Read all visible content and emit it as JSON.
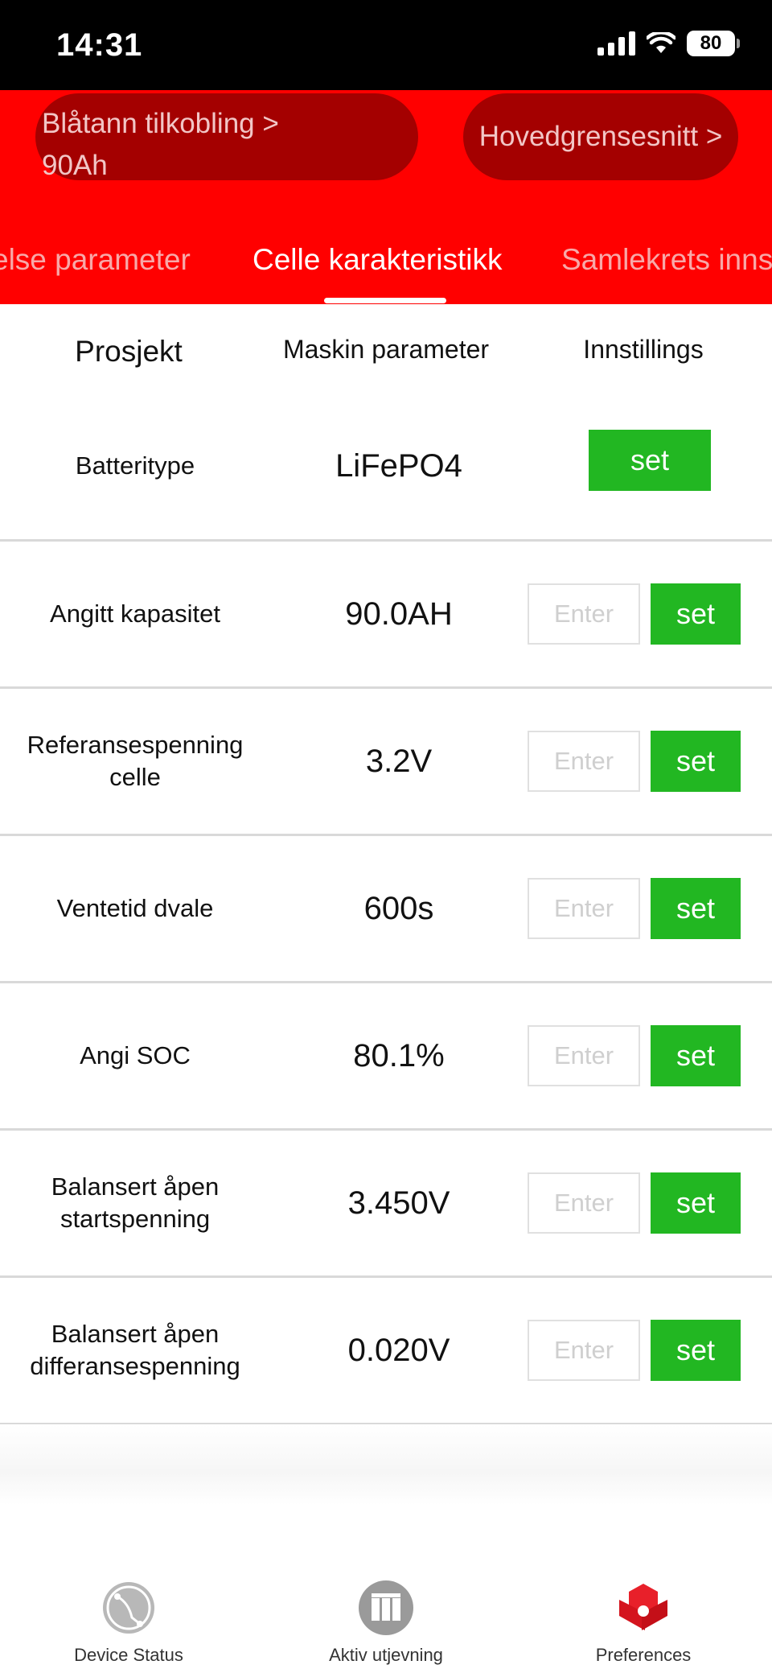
{
  "status_bar": {
    "time": "14:31",
    "battery": "80"
  },
  "header": {
    "breadcrumb_left": "Blåtann tilkobling >\n90Ah",
    "breadcrumb_right": "Hovedgrensesnitt >",
    "tabs": [
      {
        "label": "else parameter",
        "active": false
      },
      {
        "label": "Celle karakteristikk",
        "active": true
      },
      {
        "label": "Samlekrets inns",
        "active": false
      }
    ]
  },
  "table": {
    "columns": [
      "Prosjekt",
      "Maskin parameter",
      "Innstillings"
    ],
    "input_placeholder": "Enter",
    "set_label": "set",
    "rows": [
      {
        "label": "Batteritype",
        "value": "LiFePO4"
      },
      {
        "label": "Angitt kapasitet",
        "value": "90.0AH"
      },
      {
        "label": "Referansespenning celle",
        "value": "3.2V"
      },
      {
        "label": "Ventetid dvale",
        "value": "600s"
      },
      {
        "label": "Angi SOC",
        "value": "80.1%"
      },
      {
        "label": "Balansert åpen startspenning",
        "value": "3.450V"
      },
      {
        "label": "Balansert åpen differansespenning",
        "value": "0.020V"
      }
    ]
  },
  "bottom_nav": [
    {
      "label": "Device Status",
      "icon": "device-status-icon"
    },
    {
      "label": "Aktiv utjevning",
      "icon": "active-balancing-icon"
    },
    {
      "label": "Preferences",
      "icon": "preferences-icon"
    }
  ],
  "colors": {
    "header": "#ff0000",
    "pill": "#a40000",
    "set_button": "#22b722"
  }
}
